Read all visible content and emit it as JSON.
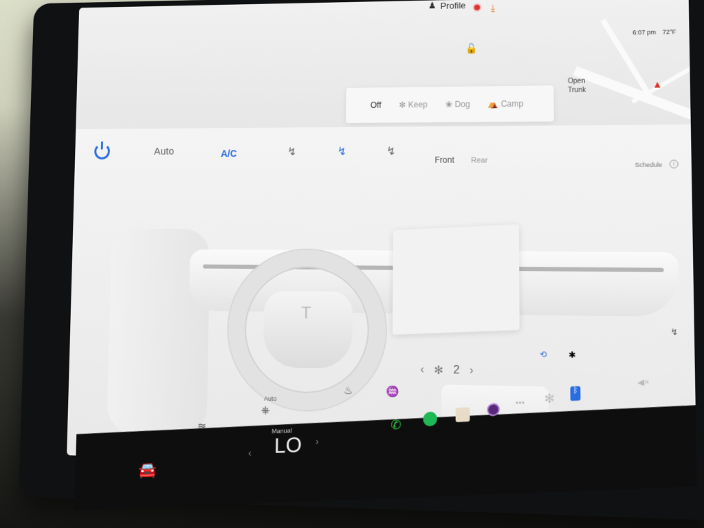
{
  "status_bar": {
    "profile_label": "Profile",
    "clock": "6:07 pm",
    "temperature": "72°F"
  },
  "map": {
    "open_trunk_label": "Open\nTrunk"
  },
  "climate_modes": {
    "off": "Off",
    "keep": "Keep",
    "dog": "Dog",
    "camp": "Camp"
  },
  "climate_toolbar": {
    "auto": "Auto",
    "ac": "A/C",
    "front": "Front",
    "rear": "Rear",
    "schedule": "Schedule"
  },
  "fan": {
    "level": "2"
  },
  "steering_heat": {
    "auto_label": "Auto"
  },
  "dock": {
    "mode_label": "Manual",
    "temperature_value": "LO"
  },
  "colors": {
    "accent": "#2a6de0",
    "phone": "#2ecc40",
    "spotify": "#1db954",
    "sentry": "#dd3333"
  }
}
